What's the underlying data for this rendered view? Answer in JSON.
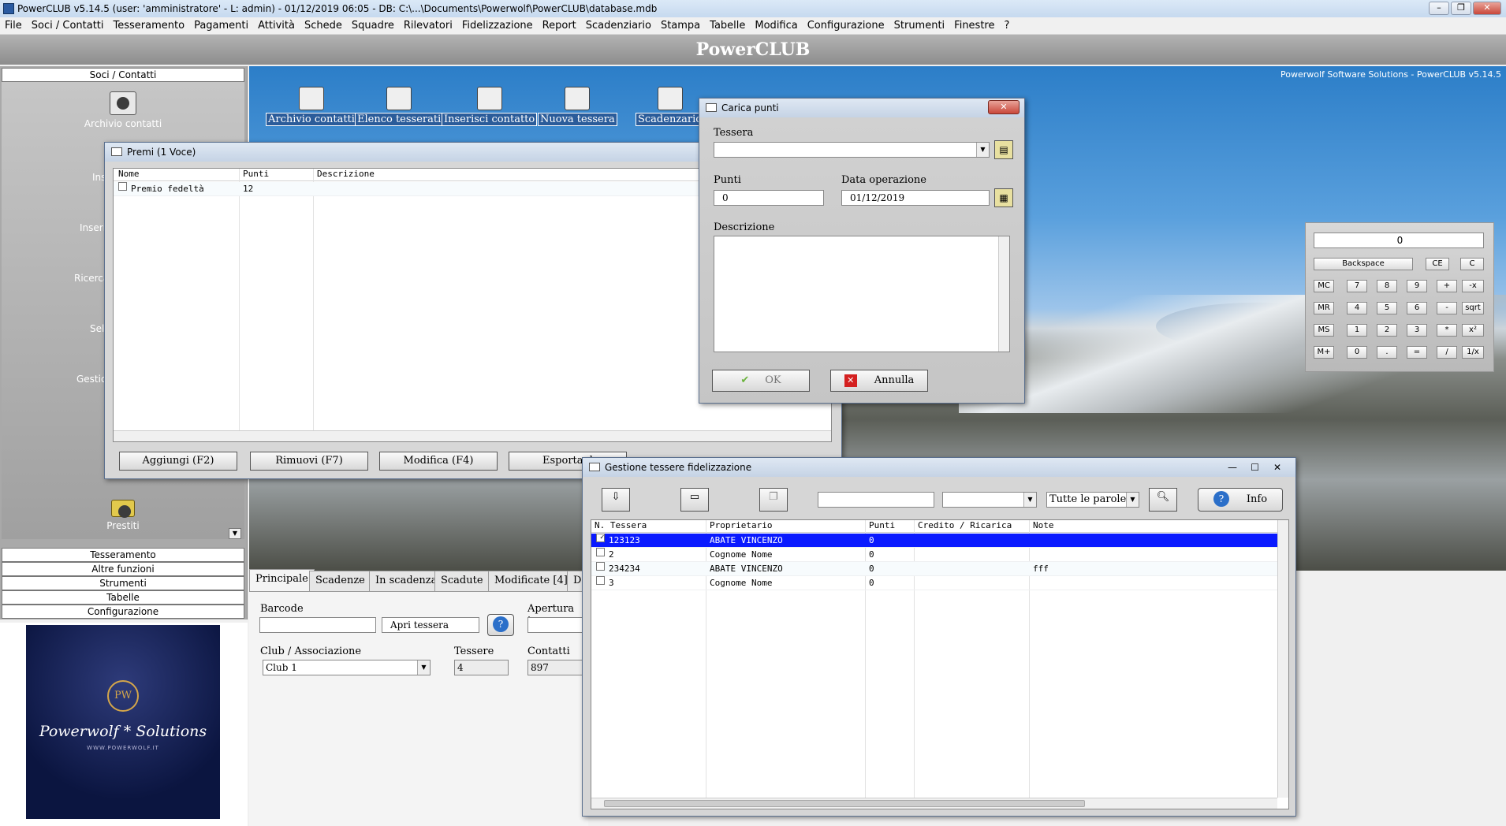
{
  "window": {
    "title": "PowerCLUB v5.14.5  (user: 'amministratore'  - L: admin) - 01/12/2019 06:05 - DB: C:\\...\\Documents\\Powerwolf\\PowerCLUB\\database.mdb"
  },
  "menu": [
    "File",
    "Soci / Contatti",
    "Tesseramento",
    "Pagamenti",
    "Attività",
    "Schede",
    "Squadre",
    "Rilevatori",
    "Fidelizzazione",
    "Report",
    "Scadenziario",
    "Stampa",
    "Tabelle",
    "Modifica",
    "Configurazione",
    "Strumenti",
    "Finestre",
    "?"
  ],
  "brand": "PowerCLUB",
  "desktop_credit": "Powerwolf Software Solutions - PowerCLUB v5.14.5",
  "sidebar": {
    "section_top": "Soci / Contatti",
    "archivio": "Archivio contatti",
    "partials": [
      "Ins",
      "Inseri",
      "Ricerca",
      "Sele",
      "Gestion"
    ],
    "prestiti": "Prestiti",
    "sections": [
      "Tesseramento",
      "Altre funzioni",
      "Strumenti",
      "Tabelle",
      "Configurazione"
    ]
  },
  "logo": {
    "initials": "PW",
    "name": "Powerwolf * Solutions",
    "url": "WWW.POWERWOLF.IT"
  },
  "toolbar": [
    "Archivio contatti",
    "Elenco tesserati",
    "Inserisci contatto",
    "Nuova tessera",
    "Scadenzario"
  ],
  "lower": {
    "tabs": [
      "Principale",
      "Scadenze",
      "In scadenza",
      "Scadute",
      "Modificate [4]",
      "D"
    ],
    "barcode_label": "Barcode",
    "apri_tessera": "Apri tessera",
    "apertura_label": "Apertura tes",
    "club_label": "Club / Associazione",
    "club_value": "Club 1",
    "tessere_label": "Tessere",
    "tessere_value": "4",
    "contatti_label": "Contatti",
    "contatti_value": "897"
  },
  "premi": {
    "title": "Premi (1 Voce)",
    "columns": [
      "Nome",
      "Punti",
      "Descrizione"
    ],
    "rows": [
      {
        "nome": "Premio fedeltà",
        "punti": "12",
        "descrizione": ""
      }
    ],
    "buttons": [
      "Aggiungi (F2)",
      "Rimuovi (F7)",
      "Modifica (F4)",
      "Esporta d"
    ]
  },
  "carica": {
    "title": "Carica punti",
    "tessera_label": "Tessera",
    "punti_label": "Punti",
    "punti_value": "0",
    "data_label": "Data operazione",
    "data_value": "01/12/2019",
    "descrizione_label": "Descrizione",
    "ok": "OK",
    "annulla": "Annulla"
  },
  "gestione": {
    "title": "Gestione tessere fidelizzazione",
    "filter": "Tutte le parole",
    "info": "Info",
    "columns": [
      "N. Tessera",
      "Proprietario",
      "Punti",
      "Credito / Ricarica",
      "Note"
    ],
    "rows": [
      {
        "n": "123123",
        "prop": "ABATE VINCENZO",
        "punti": "0",
        "credito": "",
        "note": "",
        "checked": "✓"
      },
      {
        "n": "2",
        "prop": "Cognome Nome",
        "punti": "0",
        "credito": "",
        "note": "",
        "checked": ""
      },
      {
        "n": "234234",
        "prop": "ABATE VINCENZO",
        "punti": "0",
        "credito": "",
        "note": "fff",
        "checked": ""
      },
      {
        "n": "3",
        "prop": "Cognome Nome",
        "punti": "0",
        "credito": "",
        "note": "",
        "checked": ""
      }
    ]
  },
  "calculator": {
    "display": "0",
    "top": [
      "Backspace",
      "CE",
      "C"
    ],
    "rows": [
      [
        "MC",
        "7",
        "8",
        "9",
        "+",
        "-x"
      ],
      [
        "MR",
        "4",
        "5",
        "6",
        "-",
        "sqrt"
      ],
      [
        "MS",
        "1",
        "2",
        "3",
        "*",
        "x²"
      ],
      [
        "M+",
        "0",
        ".",
        "=",
        "/",
        "1/x"
      ]
    ]
  }
}
